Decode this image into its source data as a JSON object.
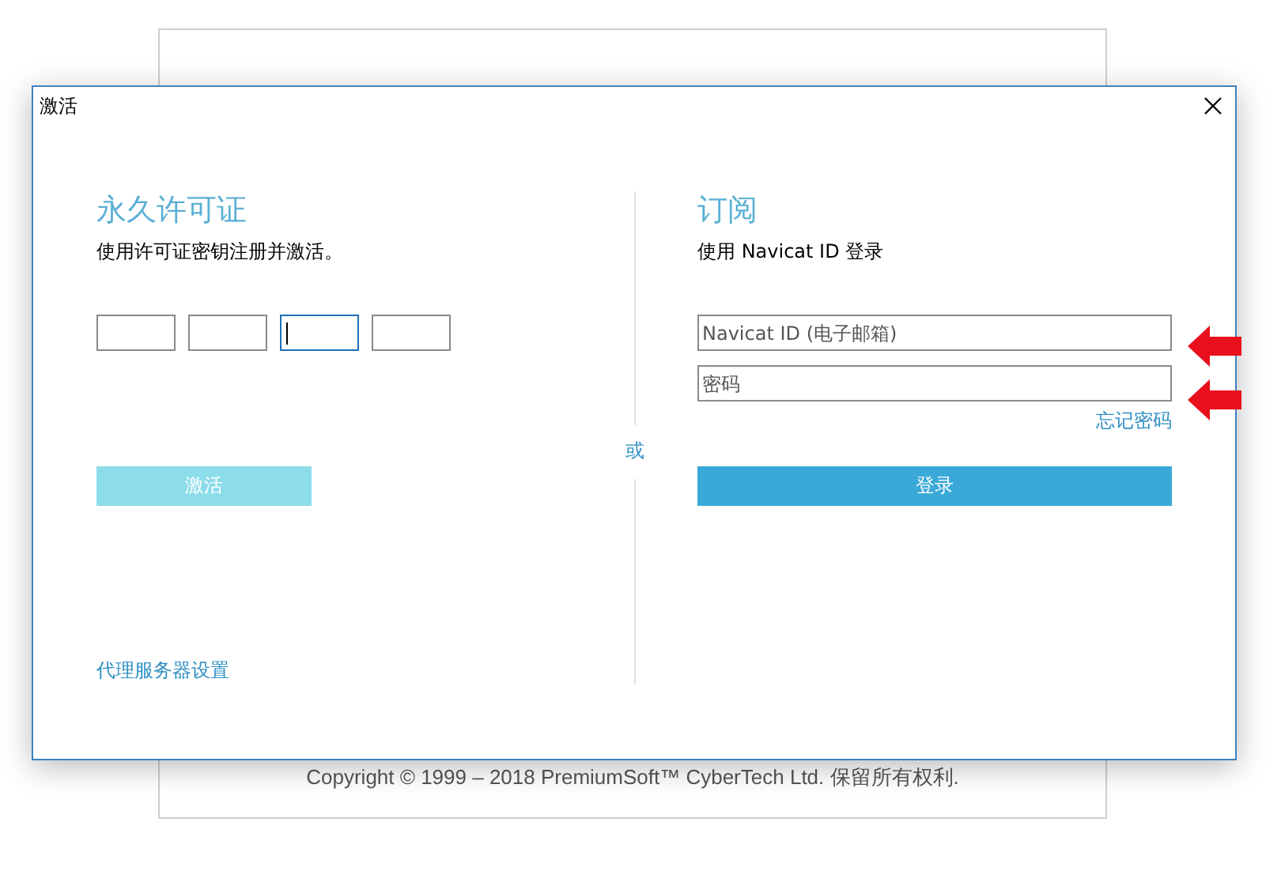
{
  "window": {
    "title": "激活"
  },
  "license": {
    "title": "永久许可证",
    "description": "使用许可证密钥注册并激活。",
    "key_fields": [
      {
        "focused": false
      },
      {
        "focused": false
      },
      {
        "focused": true
      },
      {
        "focused": false
      }
    ],
    "activate_button": {
      "label": "激活",
      "disabled": true
    }
  },
  "separator": "或",
  "subscription": {
    "title": "订阅",
    "description": "使用 Navicat ID 登录",
    "fields": [
      {
        "placeholder": "Navicat ID (电子邮箱)"
      },
      {
        "placeholder": "密码"
      }
    ],
    "forgot_link": "忘记密码",
    "login_button": {
      "label": "登录",
      "disabled": false
    }
  },
  "proxy_link": "代理服务器设置",
  "footer": {
    "copyright": "Copyright © 1999 – 2018 PremiumSoft™ CyberTech Ltd. 保留所有权利."
  }
}
